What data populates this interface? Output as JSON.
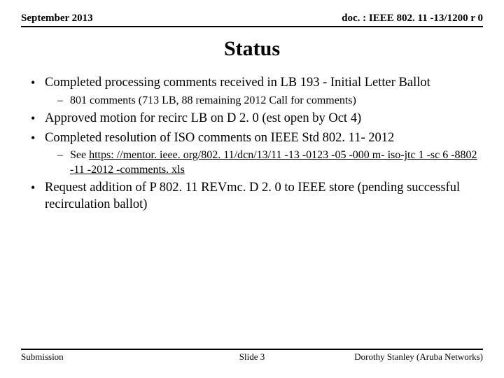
{
  "header": {
    "left": "September 2013",
    "right": "doc. : IEEE 802. 11 -13/1200 r 0"
  },
  "title": "Status",
  "bullets": [
    {
      "text": "Completed processing comments received in LB 193 - Initial Letter Ballot",
      "sub": [
        {
          "text": "801 comments (713 LB, 88 remaining 2012 Call for comments)"
        }
      ]
    },
    {
      "text": "Approved motion for recirc LB on D 2. 0 (est open by Oct 4)"
    },
    {
      "text": "Completed resolution of ISO comments on IEEE Std 802. 11- 2012",
      "sub": [
        {
          "prefix": "See ",
          "link": "https: //mentor. ieee. org/802. 11/dcn/13/11 -13 -0123 -05 -000 m- iso-jtc 1 -sc 6 -8802 -11 -2012 -comments. xls"
        }
      ]
    },
    {
      "text": "Request addition of P 802. 11 REVmc. D 2. 0 to IEEE store (pending successful recirculation ballot)"
    }
  ],
  "footer": {
    "left": "Submission",
    "center": "Slide 3",
    "right": "Dorothy Stanley (Aruba Networks)"
  }
}
